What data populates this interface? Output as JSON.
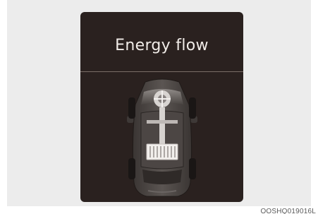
{
  "screen": {
    "title": "Energy flow"
  },
  "caption": {
    "code": "OOSHQ019016L"
  },
  "colors": {
    "background": "#ececec",
    "screen": "#2a211f",
    "title_text": "#f1ece8"
  }
}
